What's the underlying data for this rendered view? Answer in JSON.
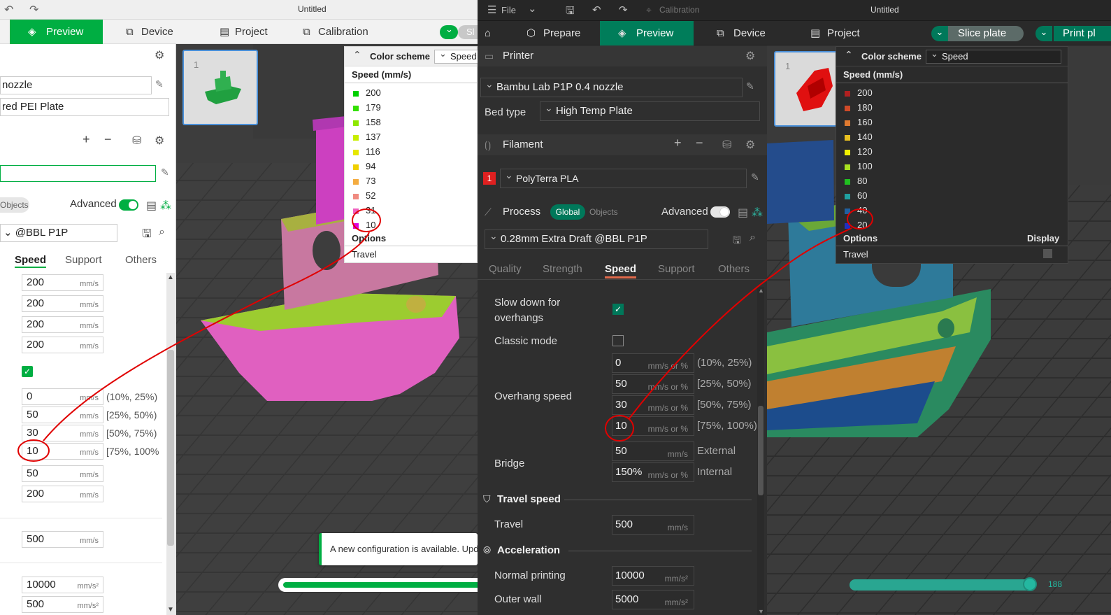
{
  "left": {
    "window_title": "Untitled",
    "tabs": [
      {
        "label": "Preview"
      },
      {
        "label": "Device"
      },
      {
        "label": "Project"
      },
      {
        "label": "Calibration"
      }
    ],
    "slice_button_partial": "Sl",
    "printer_value": "nozzle",
    "bed_type_value": "red PEI Plate",
    "objects_tab": "Objects",
    "advanced_label": "Advanced",
    "process_value": "@BBL P1P",
    "subtabs": [
      "Speed",
      "Support",
      "Others"
    ],
    "speed_values": [
      {
        "value": "200",
        "unit": "mm/s"
      },
      {
        "value": "200",
        "unit": "mm/s"
      },
      {
        "value": "200",
        "unit": "mm/s"
      },
      {
        "value": "200",
        "unit": "mm/s"
      }
    ],
    "overhang_values": [
      {
        "value": "0",
        "unit": "mm/s",
        "range": "(10%, 25%)"
      },
      {
        "value": "50",
        "unit": "mm/s",
        "range": "[25%, 50%)"
      },
      {
        "value": "30",
        "unit": "mm/s",
        "range": "[50%, 75%)"
      },
      {
        "value": "10",
        "unit": "mm/s",
        "range": "[75%, 100%"
      }
    ],
    "bridge_values": [
      {
        "value": "50",
        "unit": "mm/s"
      },
      {
        "value": "200",
        "unit": "mm/s"
      }
    ],
    "travel_value": {
      "value": "500",
      "unit": "mm/s"
    },
    "accel_values": [
      {
        "value": "10000",
        "unit": "mm/s²"
      },
      {
        "value": "500",
        "unit": "mm/s²"
      }
    ],
    "plate_number": "1",
    "legend": {
      "color_scheme_label": "Color scheme",
      "scheme_value": "Speed",
      "title": "Speed (mm/s)",
      "items": [
        {
          "label": "200",
          "color": "#00d000"
        },
        {
          "label": "179",
          "color": "#34e000"
        },
        {
          "label": "158",
          "color": "#8ee800"
        },
        {
          "label": "137",
          "color": "#c8ee00"
        },
        {
          "label": "116",
          "color": "#e6e800"
        },
        {
          "label": "94",
          "color": "#f0d000"
        },
        {
          "label": "73",
          "color": "#f4ac40"
        },
        {
          "label": "52",
          "color": "#f08a80"
        },
        {
          "label": "31",
          "color": "#f060c0"
        },
        {
          "label": "10",
          "color": "#e000e0"
        }
      ],
      "options_label": "Options",
      "travel_label": "Travel"
    },
    "notification": "A new configuration is available. Upd"
  },
  "right": {
    "window_title": "Untitled",
    "file_menu": "File",
    "calibration_disabled": "Calibration",
    "tabs": [
      {
        "label": "Prepare"
      },
      {
        "label": "Preview"
      },
      {
        "label": "Device"
      },
      {
        "label": "Project"
      }
    ],
    "slice_button": "Slice plate",
    "print_button": "Print pl",
    "printer_section": "Printer",
    "printer_value": "Bambu Lab P1P 0.4 nozzle",
    "bed_type_label": "Bed type",
    "bed_type_value": "High Temp Plate",
    "filament_section": "Filament",
    "filament_number": "1",
    "filament_value": "PolyTerra PLA",
    "process_section": "Process",
    "global_tab": "Global",
    "objects_tab": "Objects",
    "advanced_label": "Advanced",
    "process_value": "0.28mm Extra Draft @BBL P1P",
    "subtabs": [
      "Quality",
      "Strength",
      "Speed",
      "Support",
      "Others"
    ],
    "slow_down_label_1": "Slow down for",
    "slow_down_label_2": "overhangs",
    "classic_mode_label": "Classic mode",
    "overhang_speed_label": "Overhang speed",
    "overhang_values": [
      {
        "value": "0",
        "unit": "mm/s or %",
        "range": "(10%, 25%)"
      },
      {
        "value": "50",
        "unit": "mm/s or %",
        "range": "[25%, 50%)"
      },
      {
        "value": "30",
        "unit": "mm/s or %",
        "range": "[50%, 75%)"
      },
      {
        "value": "10",
        "unit": "mm/s or %",
        "range": "[75%, 100%)"
      }
    ],
    "bridge_label": "Bridge",
    "bridge_values": [
      {
        "value": "50",
        "unit": "mm/s",
        "range": "External"
      },
      {
        "value": "150%",
        "unit": "mm/s or %",
        "range": "Internal"
      }
    ],
    "travel_speed_group": "Travel speed",
    "travel_label": "Travel",
    "travel_value": {
      "value": "500",
      "unit": "mm/s"
    },
    "acceleration_group": "Acceleration",
    "normal_printing_label": "Normal printing",
    "normal_printing_value": {
      "value": "10000",
      "unit": "mm/s²"
    },
    "outer_wall_label": "Outer wall",
    "outer_wall_value": {
      "value": "5000",
      "unit": "mm/s²"
    },
    "plate_number": "1",
    "legend": {
      "color_scheme_label": "Color scheme",
      "scheme_value": "Speed",
      "title": "Speed (mm/s)",
      "items": [
        {
          "label": "200",
          "color": "#b02020"
        },
        {
          "label": "180",
          "color": "#d04a28"
        },
        {
          "label": "160",
          "color": "#e07a30"
        },
        {
          "label": "140",
          "color": "#e8c020"
        },
        {
          "label": "120",
          "color": "#f0f000"
        },
        {
          "label": "100",
          "color": "#a8e020"
        },
        {
          "label": "80",
          "color": "#20c020"
        },
        {
          "label": "60",
          "color": "#20a0a0"
        },
        {
          "label": "40",
          "color": "#2060a0"
        },
        {
          "label": "20",
          "color": "#2030c0"
        }
      ],
      "options_label": "Options",
      "display_label": "Display",
      "travel_label": "Travel"
    },
    "layer_slider_value": "188"
  }
}
